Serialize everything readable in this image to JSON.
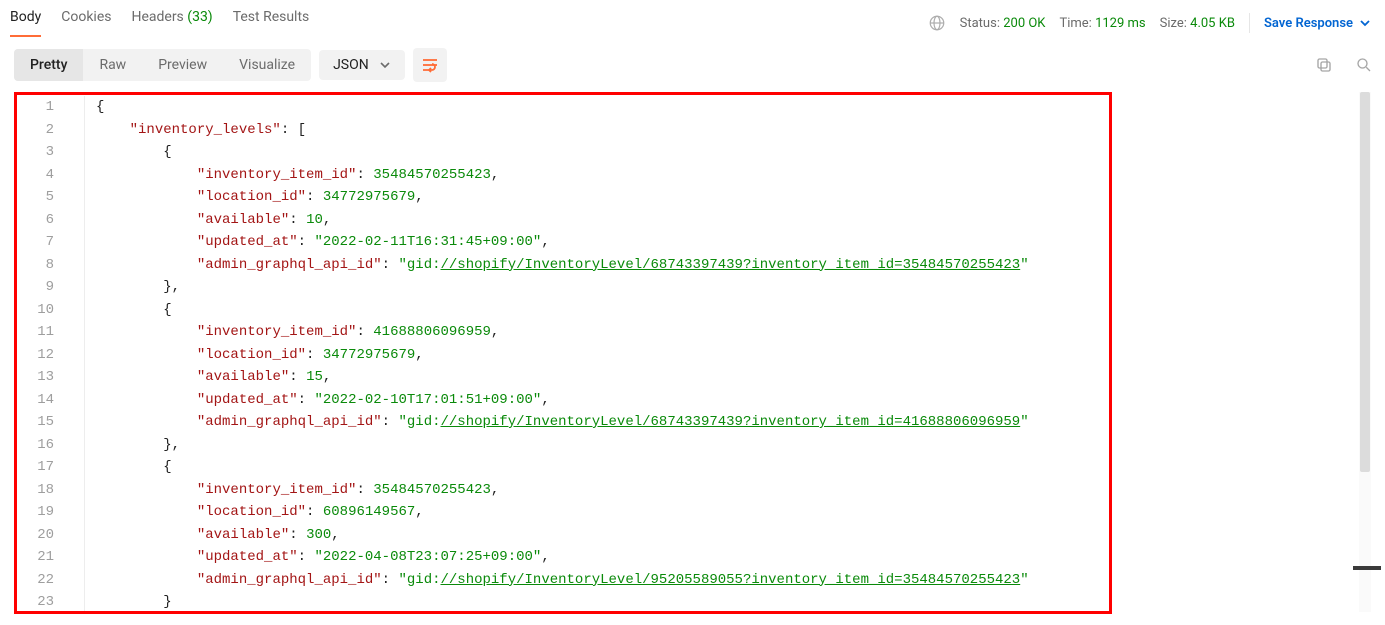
{
  "tabs": {
    "body": "Body",
    "cookies": "Cookies",
    "headers": "Headers",
    "headers_count": "(33)",
    "test_results": "Test Results"
  },
  "status": {
    "status_label": "Status:",
    "status_value": "200 OK",
    "time_label": "Time:",
    "time_value": "1129 ms",
    "size_label": "Size:",
    "size_value": "4.05 KB",
    "save": "Save Response"
  },
  "view_modes": {
    "pretty": "Pretty",
    "raw": "Raw",
    "preview": "Preview",
    "visualize": "Visualize"
  },
  "format": {
    "label": "JSON"
  },
  "response_body": {
    "inventory_levels": [
      {
        "inventory_item_id": 35484570255423,
        "location_id": 34772975679,
        "available": 10,
        "updated_at": "2022-02-11T16:31:45+09:00",
        "admin_graphql_api_id": "gid://shopify/InventoryLevel/68743397439?inventory_item_id=35484570255423"
      },
      {
        "inventory_item_id": 41688806096959,
        "location_id": 34772975679,
        "available": 15,
        "updated_at": "2022-02-10T17:01:51+09:00",
        "admin_graphql_api_id": "gid://shopify/InventoryLevel/68743397439?inventory_item_id=41688806096959"
      },
      {
        "inventory_item_id": 35484570255423,
        "location_id": 60896149567,
        "available": 300,
        "updated_at": "2022-04-08T23:07:25+09:00",
        "admin_graphql_api_id": "gid://shopify/InventoryLevel/95205589055?inventory_item_id=35484570255423"
      }
    ]
  },
  "keys": {
    "root": "inventory_levels",
    "k1": "inventory_item_id",
    "k2": "location_id",
    "k3": "available",
    "k4": "updated_at",
    "k5": "admin_graphql_api_id"
  }
}
